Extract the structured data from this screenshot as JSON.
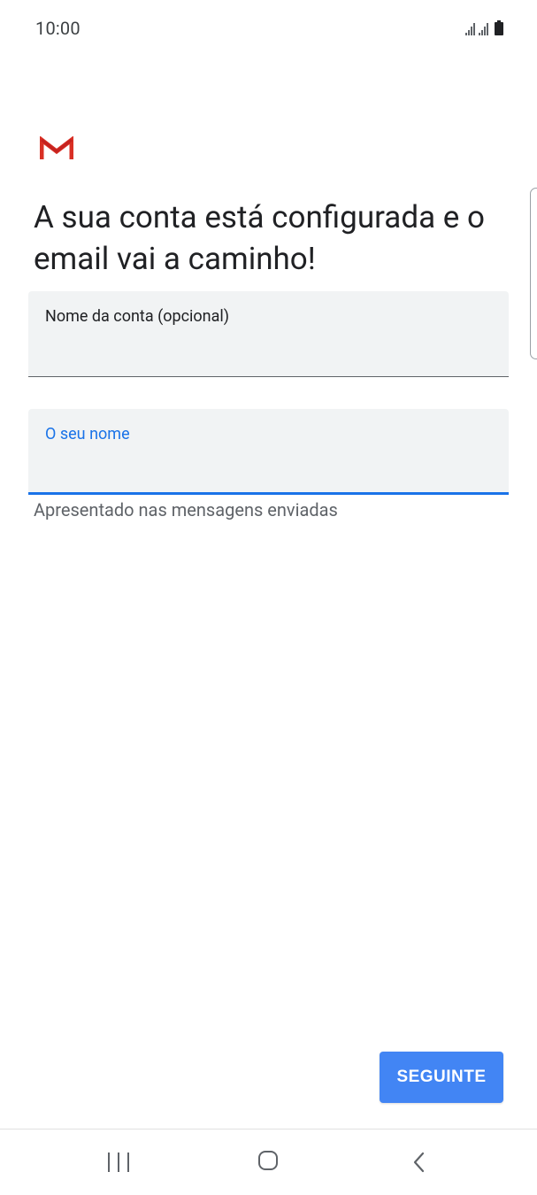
{
  "status_bar": {
    "time": "10:00",
    "icons": [
      "signal-1-icon",
      "signal-2-icon",
      "battery-icon"
    ]
  },
  "app": {
    "logo_icon": "gmail-logo-icon",
    "headline": "A sua conta está configurada e o email vai a caminho!"
  },
  "form": {
    "account_name": {
      "label": "Nome da conta (opcional)",
      "value": ""
    },
    "your_name": {
      "label": "O seu nome",
      "value": "",
      "helper": "Apresentado nas mensagens enviadas"
    }
  },
  "actions": {
    "next_label": "SEGUINTE"
  },
  "nav_bar": {
    "recents_icon": "recents-icon",
    "home_icon": "home-icon",
    "back_icon": "back-icon"
  },
  "colors": {
    "accent": "#1a73e8",
    "button": "#4285f4",
    "field_bg": "#f1f3f4",
    "gmail_red": "#d93025"
  }
}
